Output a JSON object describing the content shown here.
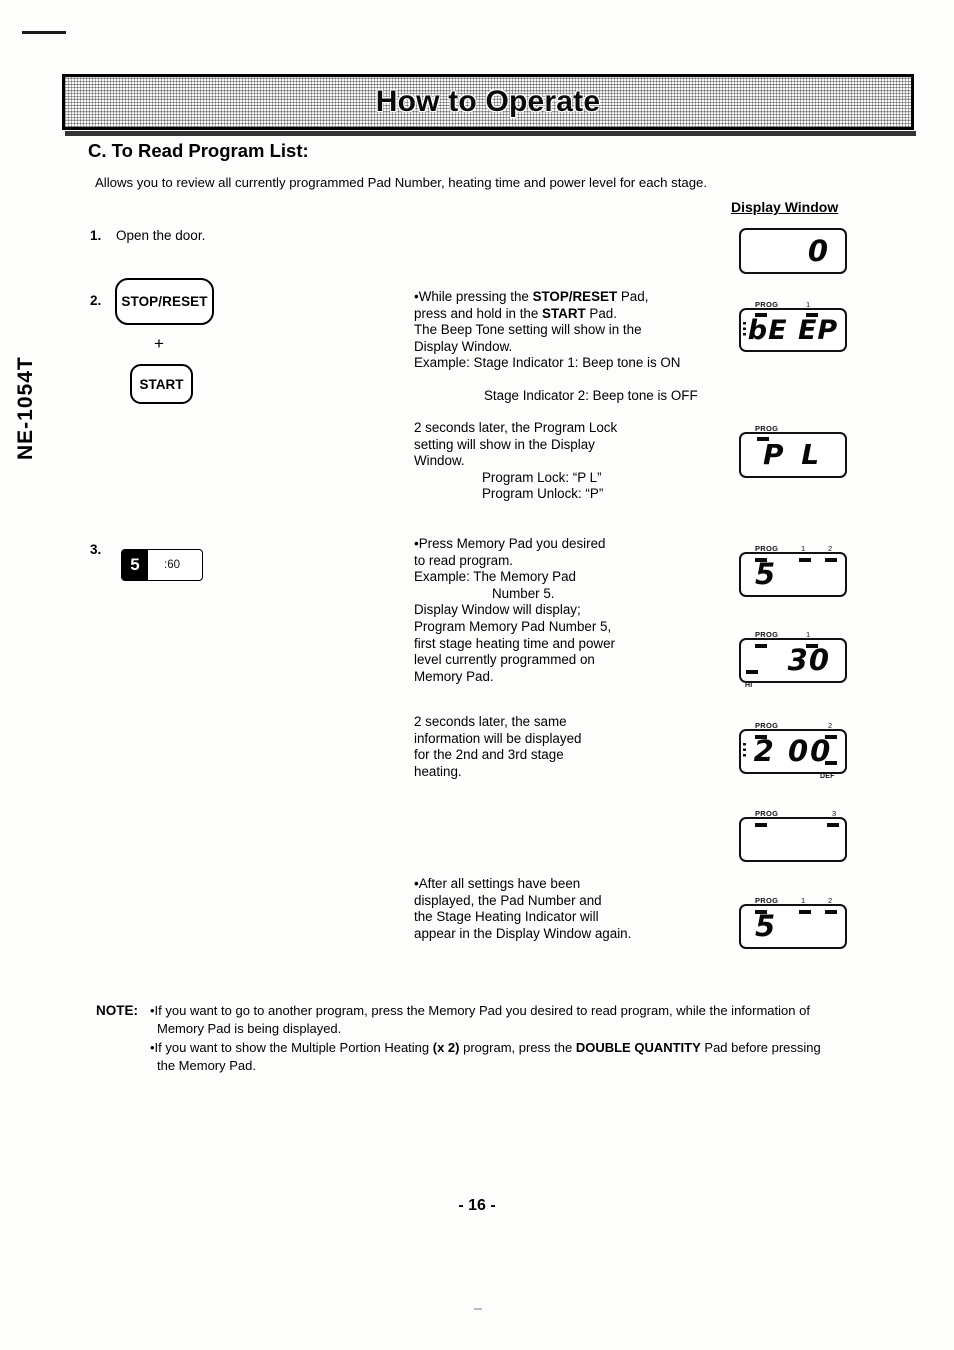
{
  "document": {
    "model_code": "NE-1054T",
    "page_number": "- 16 -",
    "banner_title": "How to Operate",
    "section_heading": "C. To Read Program List:",
    "intro": "Allows you to review all currently programmed Pad Number, heating time and power level for each stage.",
    "display_window_label": "Display Window"
  },
  "steps": [
    {
      "number": "1.",
      "text": "Open the door."
    },
    {
      "number": "2.",
      "pad_primary": "STOP/RESET",
      "plus": "+",
      "pad_secondary": "START"
    },
    {
      "number": "3.",
      "memory_pad_number": "5",
      "memory_pad_time": ":60"
    }
  ],
  "instructions": {
    "block_1": {
      "line_1": "•While pressing the ",
      "line_1_bold": "STOP/RESET",
      "line_1_end": " Pad,",
      "line_2": "press and hold in the ",
      "line_2_bold": "START",
      "line_2_end": " Pad.",
      "line_3": "The Beep Tone setting will show in the",
      "line_4": "Display Window.",
      "line_5": "Example: Stage Indicator 1: Beep tone is ON",
      "line_6": "Stage Indicator 2: Beep tone is OFF"
    },
    "block_2": {
      "line_1": "2 seconds later, the Program Lock",
      "line_2": "setting will show in the Display",
      "line_3": "Window.",
      "line_4": "Program Lock: “P L”",
      "line_5": "Program Unlock: “P”"
    },
    "block_3": {
      "line_1": "•Press Memory Pad you desired",
      "line_2": "to read program.",
      "line_3": "Example: The Memory Pad",
      "line_4": "Number 5.",
      "line_5": "Display Window will display;",
      "line_6": "Program Memory Pad Number 5,",
      "line_7": "first stage heating time and power",
      "line_8": "level currently programmed on",
      "line_9": "Memory Pad."
    },
    "block_4": {
      "line_1": "2 seconds later, the same",
      "line_2": "information will be displayed",
      "line_3": "for the 2nd and 3rd stage",
      "line_4": "heating."
    },
    "block_5": {
      "line_1": "•After all settings have been",
      "line_2": "displayed, the Pad Number and",
      "line_3": "the Stage Heating Indicator will",
      "line_4": "appear in the Display Window again."
    }
  },
  "displays": [
    {
      "id": "display-zero",
      "value": "0",
      "prog_label": "",
      "stage_labels": [],
      "under_label": ""
    },
    {
      "id": "display-beep",
      "value": "bE EP",
      "prog_label": "PROG",
      "stage_labels": [
        "1"
      ],
      "under_label": ""
    },
    {
      "id": "display-program-lock",
      "value": "P   L",
      "prog_label": "PROG",
      "stage_labels": [],
      "under_label": ""
    },
    {
      "id": "display-pad-number",
      "value": "5",
      "prog_label": "PROG",
      "stage_labels": [
        "1",
        "2"
      ],
      "under_label": ""
    },
    {
      "id": "display-stage1-time",
      "value": "30",
      "prog_label": "PROG",
      "stage_labels": [
        "1"
      ],
      "under_label": "HI"
    },
    {
      "id": "display-stage2-time",
      "value": "2 00",
      "prog_label": "PROG",
      "stage_labels": [
        "2"
      ],
      "under_label": "DEF"
    },
    {
      "id": "display-stage3-empty",
      "value": "",
      "prog_label": "PROG",
      "stage_labels": [
        "3"
      ],
      "under_label": ""
    },
    {
      "id": "display-final-pad",
      "value": "5",
      "prog_label": "PROG",
      "stage_labels": [
        "1",
        "2"
      ],
      "under_label": ""
    }
  ],
  "note": {
    "label": "NOTE:",
    "item_1a": "•If you want to go to another program, press the Memory Pad you desired to read program, while the information of",
    "item_1b": "Memory Pad is being displayed.",
    "item_2a": "•If you want to show the Multiple Portion Heating ",
    "item_2a_bold": "(x 2)",
    "item_2a_mid": " program, press the ",
    "item_2a_bold2": "DOUBLE QUANTITY",
    "item_2a_end": " Pad before pressing",
    "item_2b": "the Memory Pad."
  }
}
